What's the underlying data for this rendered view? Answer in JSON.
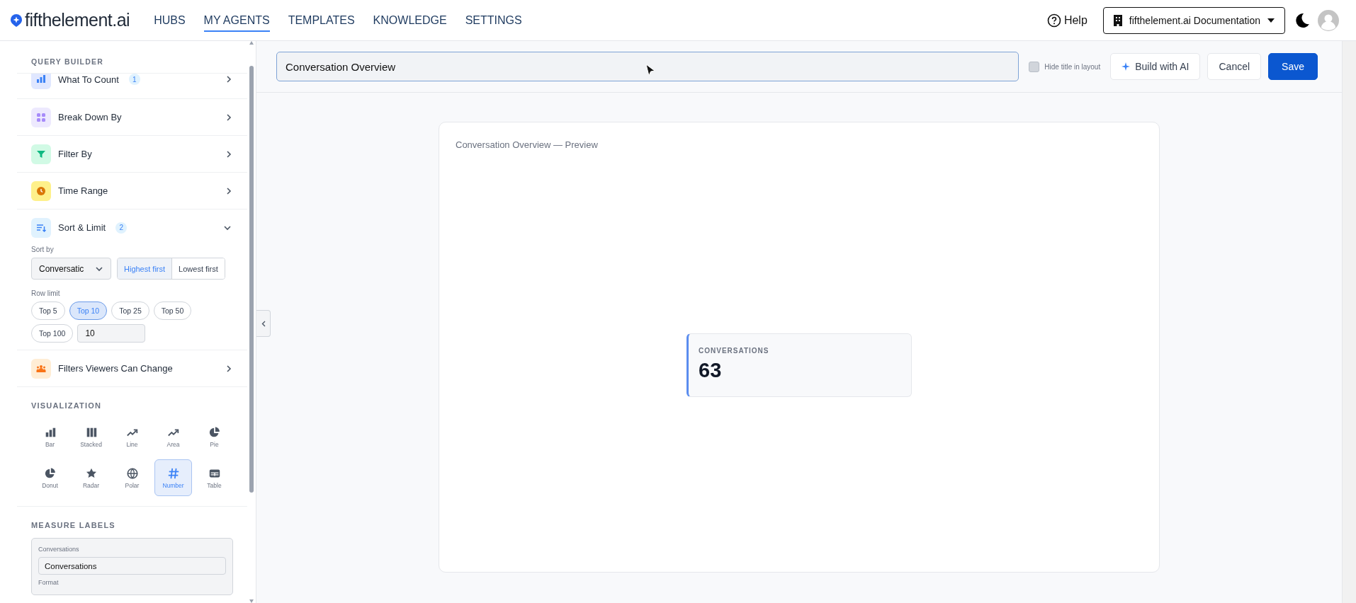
{
  "header": {
    "logo": "fifthelement.ai",
    "nav": [
      {
        "label": "HUBS",
        "selected": false
      },
      {
        "label": "MY AGENTS",
        "selected": true
      },
      {
        "label": "TEMPLATES",
        "selected": false
      },
      {
        "label": "KNOWLEDGE",
        "selected": false
      },
      {
        "label": "SETTINGS",
        "selected": false
      }
    ],
    "help": "Help",
    "workspace": "fifthelement.ai Documentation"
  },
  "sidebar": {
    "title": "QUERY BUILDER",
    "sections": [
      {
        "kind": "measure",
        "label": "What To Count",
        "count": "1",
        "expanded": false
      },
      {
        "kind": "dimension",
        "label": "Break Down By",
        "expanded": false
      },
      {
        "kind": "filter",
        "label": "Filter By",
        "expanded": false
      },
      {
        "kind": "time",
        "label": "Time Range",
        "expanded": false
      },
      {
        "kind": "sort",
        "label": "Sort & Limit",
        "count": "2",
        "expanded": true,
        "sort_by_label": "Sort by",
        "sort_field": "Conversatic",
        "order": [
          {
            "label": "Highest first",
            "selected": true
          },
          {
            "label": "Lowest first",
            "selected": false
          }
        ],
        "row_limit_label": "Row limit",
        "limits": [
          {
            "label": "Top 5",
            "selected": false
          },
          {
            "label": "Top 10",
            "selected": true
          },
          {
            "label": "Top 25",
            "selected": false
          },
          {
            "label": "Top 50",
            "selected": false
          },
          {
            "label": "Top 100",
            "selected": false
          }
        ],
        "custom_limit": "10"
      },
      {
        "kind": "viewer-filters",
        "label": "Filters Viewers Can Change",
        "expanded": false
      }
    ],
    "visualization": {
      "title": "VISUALIZATION",
      "types": [
        {
          "kind": "bar",
          "label": "Bar",
          "selected": false
        },
        {
          "kind": "stacked",
          "label": "Stacked",
          "selected": false
        },
        {
          "kind": "line",
          "label": "Line",
          "selected": false
        },
        {
          "kind": "area",
          "label": "Area",
          "selected": false
        },
        {
          "kind": "pie",
          "label": "Pie",
          "selected": false
        },
        {
          "kind": "donut",
          "label": "Donut",
          "selected": false
        },
        {
          "kind": "radar",
          "label": "Radar",
          "selected": false
        },
        {
          "kind": "polar",
          "label": "Polar",
          "selected": false
        },
        {
          "kind": "number",
          "label": "Number",
          "selected": true
        },
        {
          "kind": "table",
          "label": "Table",
          "selected": false
        }
      ]
    },
    "measure_labels": {
      "title": "MEASURE LABELS",
      "items": [
        {
          "label": "Conversations",
          "value": "Conversations",
          "format_label": "Format"
        }
      ]
    }
  },
  "toolbar": {
    "title_value": "Conversation Overview",
    "hide_title": {
      "label": "Hide title in layout",
      "checked": false
    },
    "buttons": [
      {
        "kind": "ai",
        "label": "Build with AI"
      },
      {
        "kind": "secondary",
        "label": "Cancel"
      },
      {
        "kind": "primary",
        "label": "Save"
      }
    ]
  },
  "preview": {
    "title": "Conversation Overview — Preview",
    "metric": {
      "label": "CONVERSATIONS",
      "value": "63"
    }
  }
}
